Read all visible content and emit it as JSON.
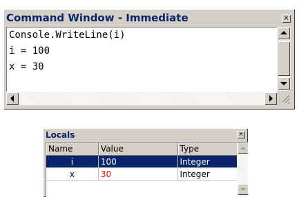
{
  "command_window": {
    "title": "Command Window - Immediate",
    "close_glyph": "×",
    "lines": [
      "Console.WriteLine(i)",
      "i = 100",
      "x = 30"
    ]
  },
  "locals_window": {
    "title": "Locals",
    "close_glyph": "×",
    "columns": [
      "Name",
      "Value",
      "Type"
    ],
    "rows": [
      {
        "name": "i",
        "value": "100",
        "type": "Integer",
        "selected": true,
        "value_changed": false
      },
      {
        "name": "x",
        "value": "30",
        "type": "Integer",
        "selected": false,
        "value_changed": true
      }
    ]
  },
  "colors": {
    "title_text": "#0a246a",
    "selection_bg": "#0a246a",
    "changed_value": "#ff0000",
    "window_face": "#d4d0c8"
  },
  "icons": {
    "scroll_up": "arrow-up-icon",
    "scroll_down": "arrow-down-icon",
    "scroll_left": "arrow-left-icon",
    "scroll_right": "arrow-right-icon",
    "close": "close-icon",
    "resize_grip": "resize-grip-icon"
  }
}
